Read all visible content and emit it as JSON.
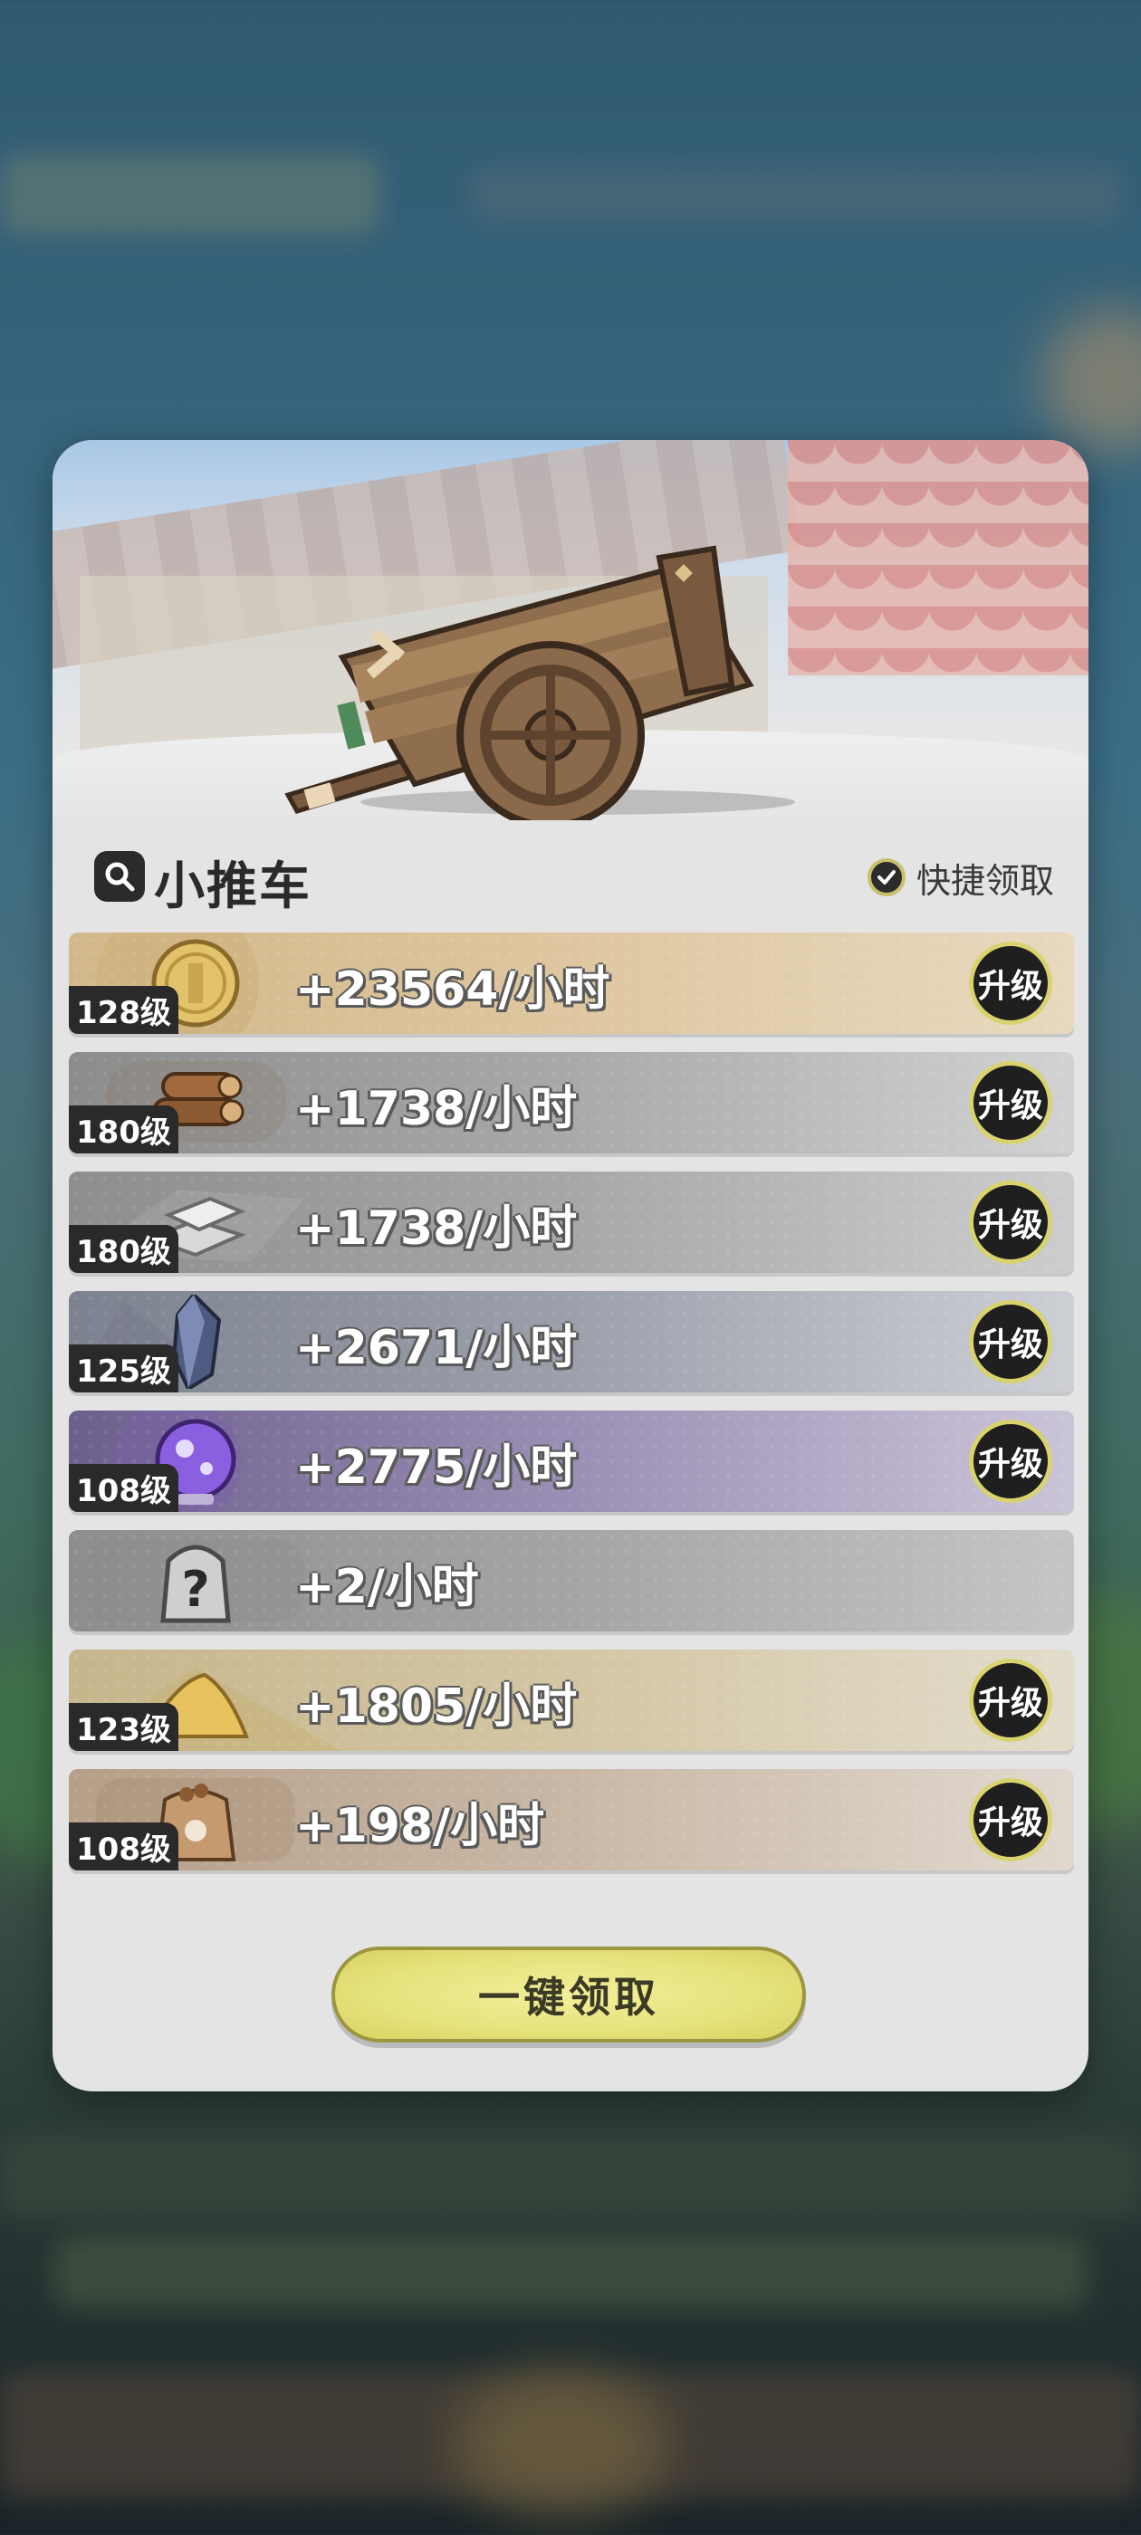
{
  "panel": {
    "title": "小推车",
    "quick_claim_label": "快捷领取",
    "claim_all_label": "一键领取"
  },
  "resources": [
    {
      "icon": "gold-coin-icon",
      "level": "128级",
      "amount": "+23564/小时",
      "upgrade": "升级"
    },
    {
      "icon": "wood-logs-icon",
      "level": "180级",
      "amount": "+1738/小时",
      "upgrade": "升级"
    },
    {
      "icon": "iron-ingot-icon",
      "level": "180级",
      "amount": "+1738/小时",
      "upgrade": "升级"
    },
    {
      "icon": "dark-crystal-icon",
      "level": "125级",
      "amount": "+2671/小时",
      "upgrade": "升级"
    },
    {
      "icon": "purple-orb-icon",
      "level": "108级",
      "amount": "+2775/小时",
      "upgrade": "升级"
    },
    {
      "icon": "mystery-bag-icon",
      "level": "",
      "amount": "+2/小时",
      "upgrade": ""
    },
    {
      "icon": "gold-sand-icon",
      "level": "123级",
      "amount": "+1805/小时",
      "upgrade": "升级"
    },
    {
      "icon": "food-sack-icon",
      "level": "108级",
      "amount": "+198/小时",
      "upgrade": "升级"
    }
  ],
  "colors": {
    "upgrade_ring": "#d8d36f",
    "claim_button": "#e6e27c",
    "panel_bg": "#e4e4e4"
  }
}
